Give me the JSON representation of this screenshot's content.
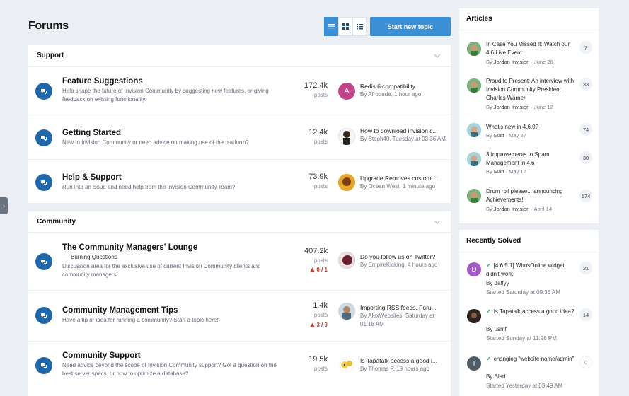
{
  "page": {
    "title": "Forums",
    "start_topic_label": "Start new topic",
    "view_modes": [
      "table-view-icon",
      "grid-view-icon",
      "list-view-icon"
    ]
  },
  "sections": [
    {
      "title": "Support",
      "forums": [
        {
          "name": "Feature Suggestions",
          "description": "Help shape the future of Invision Community by suggesting new features, or giving feedback on existing functionality.",
          "count": "172.4k",
          "count_label": "posts",
          "last_title": "Redis 6 compatibility",
          "last_meta": "By Afrodude, 1 hour ago",
          "avatar_letter": "A"
        },
        {
          "name": "Getting Started",
          "description": "New to Invision Community or need advice on making use of the platform?",
          "count": "12.4k",
          "count_label": "posts",
          "last_title": "How to download invision c...",
          "last_meta": "By Steph40, Tuesday at 03:36 AM"
        },
        {
          "name": "Help & Support",
          "description": "Run into an issue and need help from the Invision Community Team?",
          "count": "73.9k",
          "count_label": "posts",
          "last_title": "Upgrade Removes custom ...",
          "last_meta": "By Ocean West, 1 minute ago"
        }
      ]
    },
    {
      "title": "Community",
      "forums": [
        {
          "name": "The Community Managers' Lounge",
          "subforum": "Burning Questions",
          "description": "Discussion area for the exclusive use of current Invision Community clients and community managers.",
          "count": "407.2k",
          "count_label": "posts",
          "warn": "0 / 1",
          "last_title": "Do you follow us on Twitter?",
          "last_meta": "By EmpireKicking, 4 hours ago"
        },
        {
          "name": "Community Management Tips",
          "description": "Have a tip or idea for running a community? Start a topic here!",
          "count": "1.4k",
          "count_label": "posts",
          "warn": "3 / 0",
          "last_title": "Importing RSS feeds. Foru...",
          "last_meta": "By AlexWebsites, Saturday at 01:18 AM"
        },
        {
          "name": "Community Support",
          "description": "Need advice beyond the scope of Invision Community support? Got a question on the best server specs, or how to optimize a database?",
          "count": "19.5k",
          "count_label": "posts",
          "last_title": "Is Tapatalk access a good i...",
          "last_meta": "By Thomas P, 19 hours ago"
        }
      ]
    }
  ],
  "articles": {
    "title": "Articles",
    "items": [
      {
        "title": "In Case You Missed It: Watch our 4.6 Live Event",
        "by_prefix": "By",
        "author": "Jordan Invision",
        "date": "June 26",
        "count": "7"
      },
      {
        "title": "Proud to Present: An interview with Invision Community President Charles Warner",
        "by_prefix": "By",
        "author": "Jordan Invision",
        "date": "June 12",
        "count": "33"
      },
      {
        "title": "What's new in 4.6.0?",
        "by_prefix": "By",
        "author": "Matt",
        "date": "May 27",
        "count": "74"
      },
      {
        "title": "3 Improvements to Spam Management in 4.6",
        "by_prefix": "By",
        "author": "Matt",
        "date": "May 12",
        "count": "30"
      },
      {
        "title": "Drum roll please... announcing Achievements!",
        "by_prefix": "By",
        "author": "Jordan Invision",
        "date": "April 14",
        "count": "174"
      }
    ]
  },
  "recently_solved": {
    "title": "Recently Solved",
    "items": [
      {
        "title": "[4.6.5.1] WhosOnline widget didn't work",
        "by": "By daffyy",
        "when": "Started Saturday at 09:36 AM",
        "count": "21",
        "avatar_letter": "D"
      },
      {
        "title": "Is Tapatalk access a good idea?",
        "by": "By usmf",
        "when": "Started Sunday at 11:28 PM",
        "count": "14"
      },
      {
        "title": "changing \"website name/admin\"",
        "by": "By Blad",
        "when": "Started Yesterday at 03:49 AM",
        "count": "0",
        "avatar_letter": "T"
      }
    ]
  },
  "colors": {
    "accent": "#3b8fd4",
    "forum_icon": "#1f67a8",
    "solved_check": "#2ea44f",
    "warning": "#c0392b"
  },
  "icons": {
    "forum": "chat-bubble-icon",
    "collapse": "chevron-down-icon",
    "warning": "warning-triangle-icon",
    "solved": "checkmark-icon",
    "side_tab": "chevron-right-icon"
  }
}
